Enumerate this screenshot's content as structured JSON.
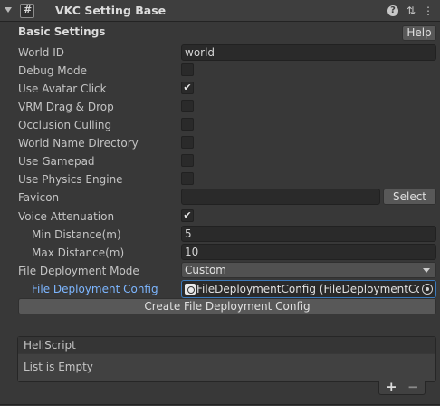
{
  "component": {
    "title": "VKC Setting Base",
    "icons": {
      "foldout": "foldout-arrow-icon",
      "script": "script-icon",
      "help": "help-icon",
      "presets": "presets-icon",
      "menu": "context-menu-icon"
    },
    "help_glyph": "?",
    "presets_glyph": "⇅",
    "menu_glyph": "⋮"
  },
  "basic_settings": {
    "title": "Basic Settings",
    "help_label": "Help"
  },
  "fields": {
    "world_id": {
      "label": "World ID",
      "value": "world"
    },
    "debug_mode": {
      "label": "Debug Mode",
      "checked": false
    },
    "use_avatar_click": {
      "label": "Use Avatar Click",
      "checked": true
    },
    "vrm_drag_drop": {
      "label": "VRM Drag & Drop",
      "checked": false
    },
    "occlusion_culling": {
      "label": "Occlusion Culling",
      "checked": false
    },
    "world_name_directory": {
      "label": "World Name Directory",
      "checked": false
    },
    "use_gamepad": {
      "label": "Use Gamepad",
      "checked": false
    },
    "use_physics_engine": {
      "label": "Use Physics Engine",
      "checked": false
    },
    "favicon": {
      "label": "Favicon",
      "value": "",
      "select_label": "Select"
    },
    "voice_attenuation": {
      "label": "Voice Attenuation",
      "checked": true
    },
    "min_distance": {
      "label": "Min Distance(m)",
      "value": "5"
    },
    "max_distance": {
      "label": "Max Distance(m)",
      "value": "10"
    },
    "file_deployment_mode": {
      "label": "File Deployment Mode",
      "value": "Custom"
    },
    "file_deployment_config": {
      "label": "File Deployment Config",
      "value": "FileDeploymentConfig (FileDeploymentConf"
    },
    "create_button_label": "Create File Deployment Config"
  },
  "check_glyph": "✔",
  "heliscript": {
    "title": "HeliScript",
    "empty_text": "List is Empty",
    "add_glyph": "+",
    "remove_glyph": "−"
  },
  "colors": {
    "background": "#383838",
    "header": "#3e3e3e",
    "field": "#2a2a2a",
    "button": "#585858",
    "highlight_label": "#7db6ff",
    "focus_border": "#3a79bb"
  }
}
